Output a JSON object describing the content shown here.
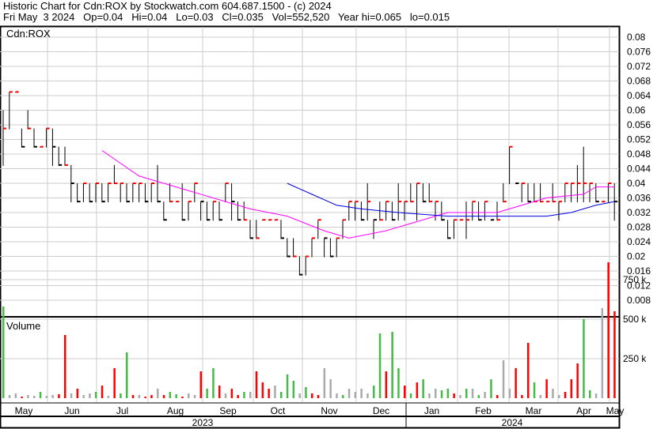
{
  "header": {
    "line1": "Historic Chart for Cdn:ROX by Stockwatch.com 604.687.1500 - (c) 2024",
    "line2": "Fri May  3 2024   Op=0.04   Hi=0.04   Lo=0.03   Cl=0.035   Vol=552,520   Year hi=0.065   lo=0.015"
  },
  "colors": {
    "up": "#ff0000",
    "down": "#000000",
    "ma_short": "#ff00ff",
    "ma_long": "#0000dd",
    "vol_up": "#44bb44",
    "vol_down": "#ff0000",
    "vol_flat": "#aaaaaa",
    "grid": "#cccccc"
  },
  "chart_data": [
    {
      "type": "ohlc",
      "title": "Cdn:ROX",
      "ylim": [
        0.004,
        0.082
      ],
      "yticks": [
        "0.08",
        "0.076",
        "0.072",
        "0.068",
        "0.064",
        "0.06",
        "0.056",
        "0.052",
        "0.048",
        "0.044",
        "0.04",
        "0.036",
        "0.032",
        "0.028",
        "0.024",
        "0.02",
        "0.016",
        "0.012",
        "0.008"
      ],
      "bars": [
        [
          0.06,
          0.045,
          0.055
        ],
        [
          0.065,
          0.055,
          0.065
        ],
        [
          0.065,
          0.065,
          0.065
        ],
        [
          0.055,
          0.05,
          0.05
        ],
        [
          0.06,
          0.055,
          0.055
        ],
        [
          0.055,
          0.05,
          0.05
        ],
        [
          0.05,
          0.05,
          0.05
        ],
        [
          0.055,
          0.05,
          0.055
        ],
        [
          0.055,
          0.045,
          0.05
        ],
        [
          0.05,
          0.045,
          0.045
        ],
        [
          0.05,
          0.045,
          0.045
        ],
        [
          0.045,
          0.035,
          0.04
        ],
        [
          0.04,
          0.035,
          0.035
        ],
        [
          0.04,
          0.035,
          0.04
        ],
        [
          0.04,
          0.035,
          0.035
        ],
        [
          0.04,
          0.035,
          0.04
        ],
        [
          0.04,
          0.035,
          0.035
        ],
        [
          0.04,
          0.035,
          0.04
        ],
        [
          0.045,
          0.04,
          0.04
        ],
        [
          0.04,
          0.035,
          0.04
        ],
        [
          0.04,
          0.035,
          0.035
        ],
        [
          0.04,
          0.035,
          0.04
        ],
        [
          0.04,
          0.035,
          0.04
        ],
        [
          0.04,
          0.035,
          0.035
        ],
        [
          0.04,
          0.035,
          0.04
        ],
        [
          0.045,
          0.035,
          0.035
        ],
        [
          0.035,
          0.03,
          0.03
        ],
        [
          0.04,
          0.035,
          0.035
        ],
        [
          0.035,
          0.035,
          0.035
        ],
        [
          0.04,
          0.03,
          0.03
        ],
        [
          0.035,
          0.03,
          0.035
        ],
        [
          0.04,
          0.035,
          0.04
        ],
        [
          0.035,
          0.03,
          0.035
        ],
        [
          0.035,
          0.03,
          0.03
        ],
        [
          0.035,
          0.03,
          0.035
        ],
        [
          0.035,
          0.03,
          0.03
        ],
        [
          0.04,
          0.035,
          0.04
        ],
        [
          0.04,
          0.03,
          0.035
        ],
        [
          0.035,
          0.03,
          0.03
        ],
        [
          0.035,
          0.03,
          0.03
        ],
        [
          0.03,
          0.025,
          0.025
        ],
        [
          0.03,
          0.025,
          0.025
        ],
        [
          0.03,
          0.03,
          0.03
        ],
        [
          0.03,
          0.03,
          0.03
        ],
        [
          0.03,
          0.03,
          0.03
        ],
        [
          0.03,
          0.025,
          0.025
        ],
        [
          0.025,
          0.02,
          0.02
        ],
        [
          0.025,
          0.02,
          0.02
        ],
        [
          0.02,
          0.015,
          0.015
        ],
        [
          0.02,
          0.015,
          0.02
        ],
        [
          0.025,
          0.02,
          0.025
        ],
        [
          0.03,
          0.025,
          0.03
        ],
        [
          0.025,
          0.02,
          0.025
        ],
        [
          0.025,
          0.02,
          0.02
        ],
        [
          0.025,
          0.02,
          0.025
        ],
        [
          0.03,
          0.025,
          0.03
        ],
        [
          0.035,
          0.03,
          0.035
        ],
        [
          0.035,
          0.03,
          0.035
        ],
        [
          0.035,
          0.03,
          0.03
        ],
        [
          0.04,
          0.03,
          0.035
        ],
        [
          0.03,
          0.025,
          0.03
        ],
        [
          0.035,
          0.03,
          0.03
        ],
        [
          0.035,
          0.03,
          0.035
        ],
        [
          0.035,
          0.03,
          0.03
        ],
        [
          0.04,
          0.03,
          0.035
        ],
        [
          0.035,
          0.03,
          0.035
        ],
        [
          0.04,
          0.035,
          0.035
        ],
        [
          0.04,
          0.03,
          0.04
        ],
        [
          0.04,
          0.035,
          0.035
        ],
        [
          0.04,
          0.035,
          0.035
        ],
        [
          0.035,
          0.03,
          0.035
        ],
        [
          0.035,
          0.03,
          0.03
        ],
        [
          0.03,
          0.025,
          0.025
        ],
        [
          0.03,
          0.025,
          0.03
        ],
        [
          0.03,
          0.03,
          0.03
        ],
        [
          0.035,
          0.025,
          0.03
        ],
        [
          0.035,
          0.03,
          0.035
        ],
        [
          0.035,
          0.03,
          0.03
        ],
        [
          0.035,
          0.03,
          0.035
        ],
        [
          0.03,
          0.03,
          0.03
        ],
        [
          0.035,
          0.03,
          0.03
        ],
        [
          0.04,
          0.035,
          0.035
        ],
        [
          0.05,
          0.04,
          0.05
        ],
        [
          0.04,
          0.04,
          0.04
        ],
        [
          0.04,
          0.035,
          0.04
        ],
        [
          0.04,
          0.035,
          0.035
        ],
        [
          0.04,
          0.035,
          0.035
        ],
        [
          0.04,
          0.035,
          0.035
        ],
        [
          0.035,
          0.035,
          0.035
        ],
        [
          0.04,
          0.035,
          0.035
        ],
        [
          0.035,
          0.03,
          0.035
        ],
        [
          0.04,
          0.035,
          0.04
        ],
        [
          0.04,
          0.035,
          0.04
        ],
        [
          0.045,
          0.035,
          0.04
        ],
        [
          0.05,
          0.035,
          0.04
        ],
        [
          0.04,
          0.035,
          0.04
        ],
        [
          0.04,
          0.035,
          0.035
        ],
        [
          0.035,
          0.035,
          0.035
        ],
        [
          0.04,
          0.035,
          0.04
        ],
        [
          0.04,
          0.03,
          0.035
        ]
      ],
      "ma_short": [
        [
          16,
          0.049
        ],
        [
          22,
          0.042
        ],
        [
          30,
          0.038
        ],
        [
          36,
          0.035
        ],
        [
          40,
          0.033
        ],
        [
          46,
          0.031
        ],
        [
          52,
          0.027
        ],
        [
          56,
          0.025
        ],
        [
          62,
          0.027
        ],
        [
          68,
          0.03
        ],
        [
          72,
          0.032
        ],
        [
          80,
          0.032
        ],
        [
          84,
          0.034
        ],
        [
          88,
          0.036
        ],
        [
          94,
          0.037
        ],
        [
          96,
          0.039
        ],
        [
          99,
          0.039
        ]
      ],
      "ma_long": [
        [
          46,
          0.04
        ],
        [
          50,
          0.037
        ],
        [
          54,
          0.034
        ],
        [
          58,
          0.033
        ],
        [
          64,
          0.032
        ],
        [
          72,
          0.031
        ],
        [
          80,
          0.031
        ],
        [
          88,
          0.031
        ],
        [
          92,
          0.032
        ],
        [
          96,
          0.034
        ],
        [
          99,
          0.035
        ]
      ]
    },
    {
      "type": "bar",
      "title": "Volume",
      "yticks": [
        "750 k",
        "500 k",
        "250 k"
      ],
      "ylim": [
        0,
        900
      ],
      "values": [
        580,
        20,
        30,
        10,
        20,
        15,
        40,
        15,
        20,
        25,
        400,
        30,
        60,
        20,
        30,
        40,
        80,
        15,
        190,
        30,
        290,
        20,
        20,
        10,
        20,
        60,
        20,
        40,
        25,
        10,
        30,
        20,
        170,
        60,
        190,
        80,
        30,
        60,
        20,
        40,
        40,
        170,
        100,
        60,
        80,
        40,
        150,
        110,
        30,
        70,
        30,
        20,
        190,
        120,
        30,
        20,
        60,
        40,
        60,
        30,
        80,
        410,
        170,
        420,
        190,
        80,
        30,
        100,
        120,
        30,
        60,
        50,
        60,
        30,
        20,
        60,
        60,
        20,
        40,
        120,
        20,
        240,
        60,
        190,
        20,
        350,
        100,
        20,
        120,
        60,
        20,
        40,
        120,
        220,
        500,
        50,
        30,
        570,
        860,
        550
      ],
      "colors": [
        "g",
        "n",
        "n",
        "r",
        "n",
        "n",
        "g",
        "n",
        "n",
        "r",
        "r",
        "n",
        "r",
        "n",
        "n",
        "g",
        "r",
        "n",
        "r",
        "g",
        "g",
        "r",
        "n",
        "r",
        "r",
        "n",
        "r",
        "g",
        "g",
        "r",
        "n",
        "n",
        "r",
        "g",
        "g",
        "r",
        "n",
        "r",
        "r",
        "g",
        "n",
        "r",
        "r",
        "r",
        "n",
        "g",
        "g",
        "g",
        "n",
        "g",
        "r",
        "r",
        "n",
        "n",
        "n",
        "g",
        "n",
        "n",
        "n",
        "n",
        "g",
        "g",
        "r",
        "g",
        "g",
        "r",
        "g",
        "r",
        "g",
        "n",
        "n",
        "g",
        "g",
        "r",
        "n",
        "g",
        "n",
        "g",
        "n",
        "g",
        "r",
        "n",
        "n",
        "r",
        "r",
        "r",
        "g",
        "n",
        "r",
        "n",
        "n",
        "r",
        "r",
        "r",
        "g",
        "g",
        "n",
        "n",
        "r",
        "r"
      ]
    },
    {
      "type": "axis",
      "months": [
        "May",
        "Jun",
        "Jul",
        "Aug",
        "Sep",
        "Oct",
        "Nov",
        "Dec",
        "Jan",
        "Feb",
        "Mar",
        "Apr",
        "May"
      ],
      "years": [
        "2023",
        "2024"
      ]
    }
  ]
}
